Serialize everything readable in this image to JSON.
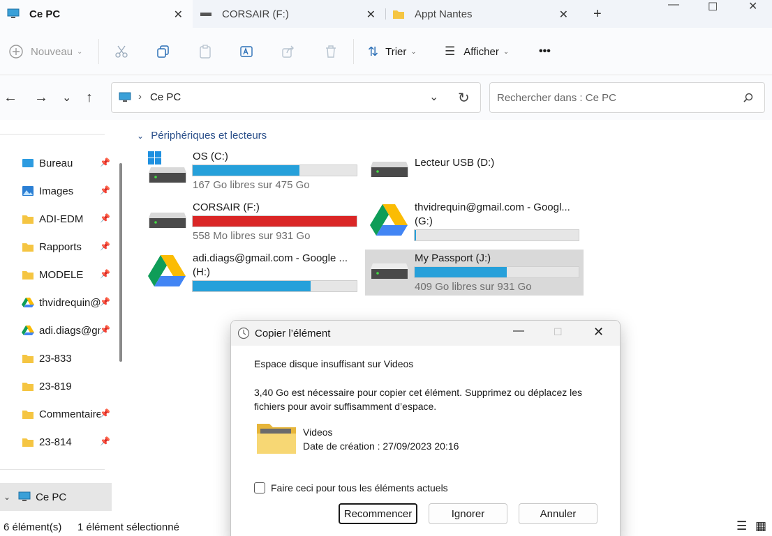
{
  "tabs": [
    {
      "label": "Ce PC"
    },
    {
      "label": "CORSAIR (F:)"
    },
    {
      "label": "Appt Nantes"
    }
  ],
  "toolbar": {
    "new_label": "Nouveau",
    "sort_label": "Trier",
    "view_label": "Afficher",
    "more_label": "•••"
  },
  "address": {
    "path": "Ce PC",
    "search_placeholder": "Rechercher dans : Ce PC"
  },
  "sidebar": {
    "items": [
      {
        "label": "Bureau"
      },
      {
        "label": "Images"
      },
      {
        "label": "ADI-EDM"
      },
      {
        "label": "Rapports"
      },
      {
        "label": "MODELE"
      },
      {
        "label": "thvidrequin@gmail.com"
      },
      {
        "label": "adi.diags@gmail.com"
      },
      {
        "label": "23-833"
      },
      {
        "label": "23-819"
      },
      {
        "label": "Commentaires"
      },
      {
        "label": "23-814"
      }
    ],
    "this_pc_label": "Ce PC"
  },
  "section": {
    "title": "Périphériques et lecteurs"
  },
  "drives": [
    {
      "name": "OS (C:)",
      "free": "167 Go libres sur 475 Go",
      "used_fraction": 0.65,
      "color": "#26a0da"
    },
    {
      "name": "Lecteur USB (D:)"
    },
    {
      "name": "CORSAIR (F:)",
      "free": "558 Mo libres sur 931 Go",
      "used_fraction": 0.999,
      "color": "#da2626"
    },
    {
      "name": "thvidrequin@gmail.com - Googl...",
      "name2": "(G:)",
      "used_fraction": 0.01,
      "color": "#26a0da"
    },
    {
      "name": "adi.diags@gmail.com - Google ...",
      "name2": "(H:)",
      "used_fraction": 0.72,
      "color": "#26a0da"
    },
    {
      "name": "My Passport (J:)",
      "free": "409 Go libres sur 931 Go",
      "used_fraction": 0.56,
      "color": "#26a0da"
    }
  ],
  "status": {
    "count": "6 élément(s)",
    "selected": "1 élément sélectionné"
  },
  "dialog": {
    "title": "Copier l’élément",
    "heading": "Espace disque insuffisant sur Videos",
    "message": "3,40 Go est nécessaire pour copier cet élément. Supprimez ou déplacez les fichiers pour avoir suffisamment d’espace.",
    "item_name": "Videos",
    "item_date": "Date de création : 27/09/2023 20:16",
    "checkbox_label": "Faire ceci pour tous les éléments actuels",
    "retry_label": "Recommencer",
    "ignore_label": "Ignorer",
    "cancel_label": "Annuler"
  }
}
